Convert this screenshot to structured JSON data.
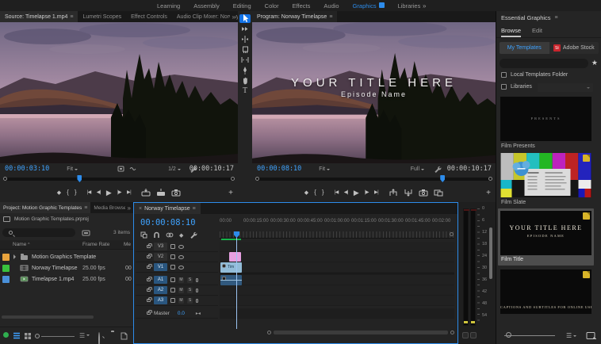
{
  "icons": {
    "menu": "≡",
    "overflow": "»",
    "close": "×",
    "star": "★",
    "marker": "◆",
    "brace_in": "{",
    "brace_out": "}",
    "go_in": "|◀",
    "step_back": "◀|",
    "play": "▶",
    "step_fwd": "|▶",
    "go_out": "▶|",
    "plus": "+",
    "fit": "▸◂",
    "type_tool": "T",
    "sort": "☰",
    "caret_up": "^"
  },
  "topbar": {
    "tabs": [
      "Learning",
      "Assembly",
      "Editing",
      "Color",
      "Effects",
      "Audio",
      "Graphics",
      "Libraries"
    ],
    "active_tab": "Graphics"
  },
  "source": {
    "tab": "Source: Timelapse 1.mp4",
    "tab_lumetri": "Lumetri Scopes",
    "tab_effects": "Effect Controls",
    "tab_mixer": "Audio Clip Mixer: Norway Timelapse",
    "timecode": "00:00:03:10",
    "zoom_level": "Fit",
    "playback_resolution": "1/2",
    "duration": "00:00:10:17"
  },
  "program": {
    "tab": "Program: Norway Timelapse",
    "timecode": "00:00:08:10",
    "zoom_level": "Fit",
    "playback_resolution": "Full",
    "duration": "00:00:10:17",
    "overlay_title": "YOUR TITLE HERE",
    "overlay_subtitle": "Episode Name"
  },
  "project": {
    "tab": "Project: Motion Graphic Templates",
    "tab_media": "Media Browser",
    "bin_path": "Motion Graphic Templates.prproj",
    "item_count": "3 items",
    "columns": {
      "name": "Name",
      "frame_rate": "Frame Rate",
      "media": "Me"
    },
    "rows": [
      {
        "name": "Motion Graphics Template",
        "frame_rate": "",
        "media": ""
      },
      {
        "name": "Norway Timelapse",
        "frame_rate": "25.00 fps",
        "media": "00"
      },
      {
        "name": "Timelapse 1.mp4",
        "frame_rate": "25.00 fps",
        "media": "00"
      }
    ]
  },
  "timeline": {
    "tab": "Norway Timelapse",
    "timecode": "00:00:08:10",
    "ruler": [
      "00:00",
      "00:00:15:00",
      "00:00:30:00",
      "00:00:45:00",
      "00:01:00:00",
      "00:01:15:00",
      "00:01:30:00",
      "00:01:45:00",
      "00:02:00"
    ],
    "video_tracks": [
      "V3",
      "V2",
      "V1"
    ],
    "audio_tracks": [
      "A1",
      "A2",
      "A3"
    ],
    "master_label": "Master",
    "master_level": "0.0",
    "mute": "M",
    "solo": "S",
    "clip_label": "Tim"
  },
  "meters": {
    "scale": [
      "0",
      "6",
      "12",
      "18",
      "24",
      "30",
      "36",
      "42",
      "48",
      "54"
    ]
  },
  "eg": {
    "title": "Essential Graphics",
    "tab_browse": "Browse",
    "tab_edit": "Edit",
    "btn_my_templates": "My Templates",
    "btn_adobe_stock": "Adobe Stock",
    "stock_badge": "St",
    "chk_local": "Local Templates Folder",
    "chk_libraries": "Libraries",
    "t1_label": "Film Presents",
    "t1_text": "PRESENTS",
    "t2_label": "Film Slate",
    "t3_label": "Film Title",
    "t3_title": "YOUR TITLE HERE",
    "t3_subtitle": "EPISODE NAME",
    "t4_caption": "CAPTIONS AND SUBTITLES FOR ONLINE USE"
  },
  "colors": {
    "accent_blue": "#2d8ceb",
    "timecode_blue": "#3fa3ff",
    "render_green": "#17b34a",
    "clip_video": "#92bcd8",
    "clip_audio": "#31597e",
    "clip_graphic": "#e69fe0",
    "label_orange": "#e8a33d",
    "label_green": "#39c13d",
    "label_blue": "#4a90d9",
    "mogrt_badge": "#d8b428",
    "stock_red": "#c9252d"
  }
}
